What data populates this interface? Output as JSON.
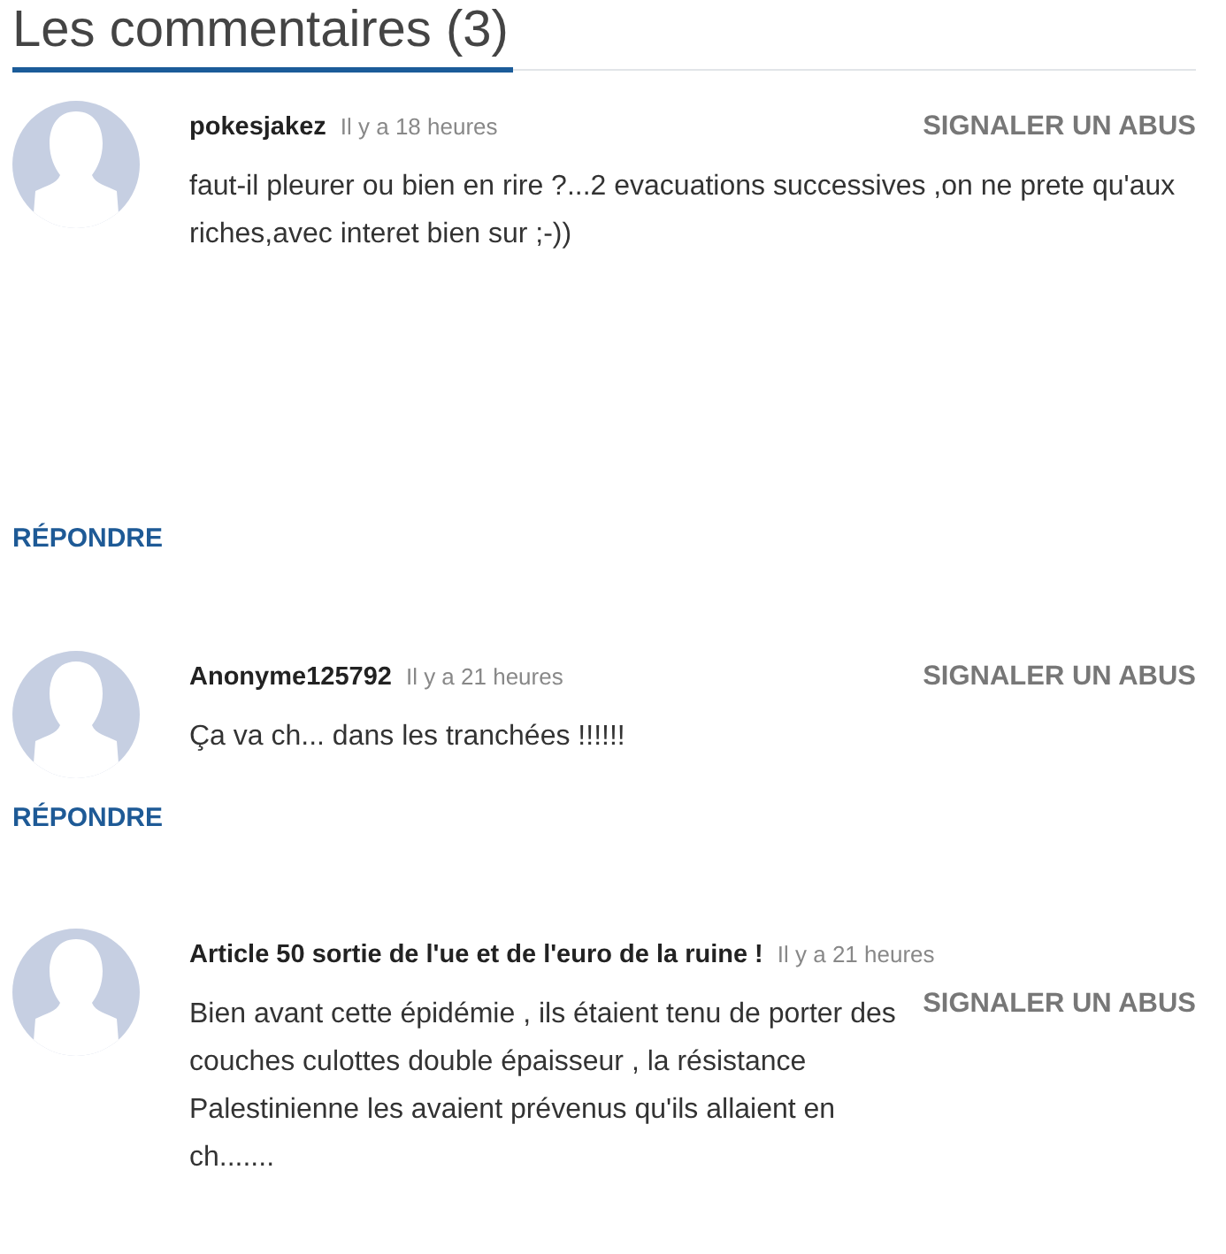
{
  "section": {
    "title": "Les commentaires (3)"
  },
  "comments": [
    {
      "author": "pokesjakez",
      "time": "Il y a 18 heures",
      "report": "SIGNALER UN ABUS",
      "text": "faut-il pleurer ou bien en rire ?...2 evacuations successives ,on ne prete qu'aux riches,avec interet bien sur ;-))",
      "reply": "RÉPONDRE"
    },
    {
      "author": "Anonyme125792",
      "time": "Il y a 21 heures",
      "report": "SIGNALER UN ABUS",
      "text": "Ça va ch... dans les tranchées !!!!!!",
      "reply": "RÉPONDRE"
    },
    {
      "author": "Article 50 sortie de l'ue et de l'euro de la ruine !",
      "time": "Il y a 21 heures",
      "report": "SIGNALER UN ABUS",
      "text": "Bien avant cette épidémie , ils étaient tenu de porter des couches culottes double épaisseur , la résistance Palestinienne les avaient prévenus qu'ils allaient en ch......."
    }
  ]
}
